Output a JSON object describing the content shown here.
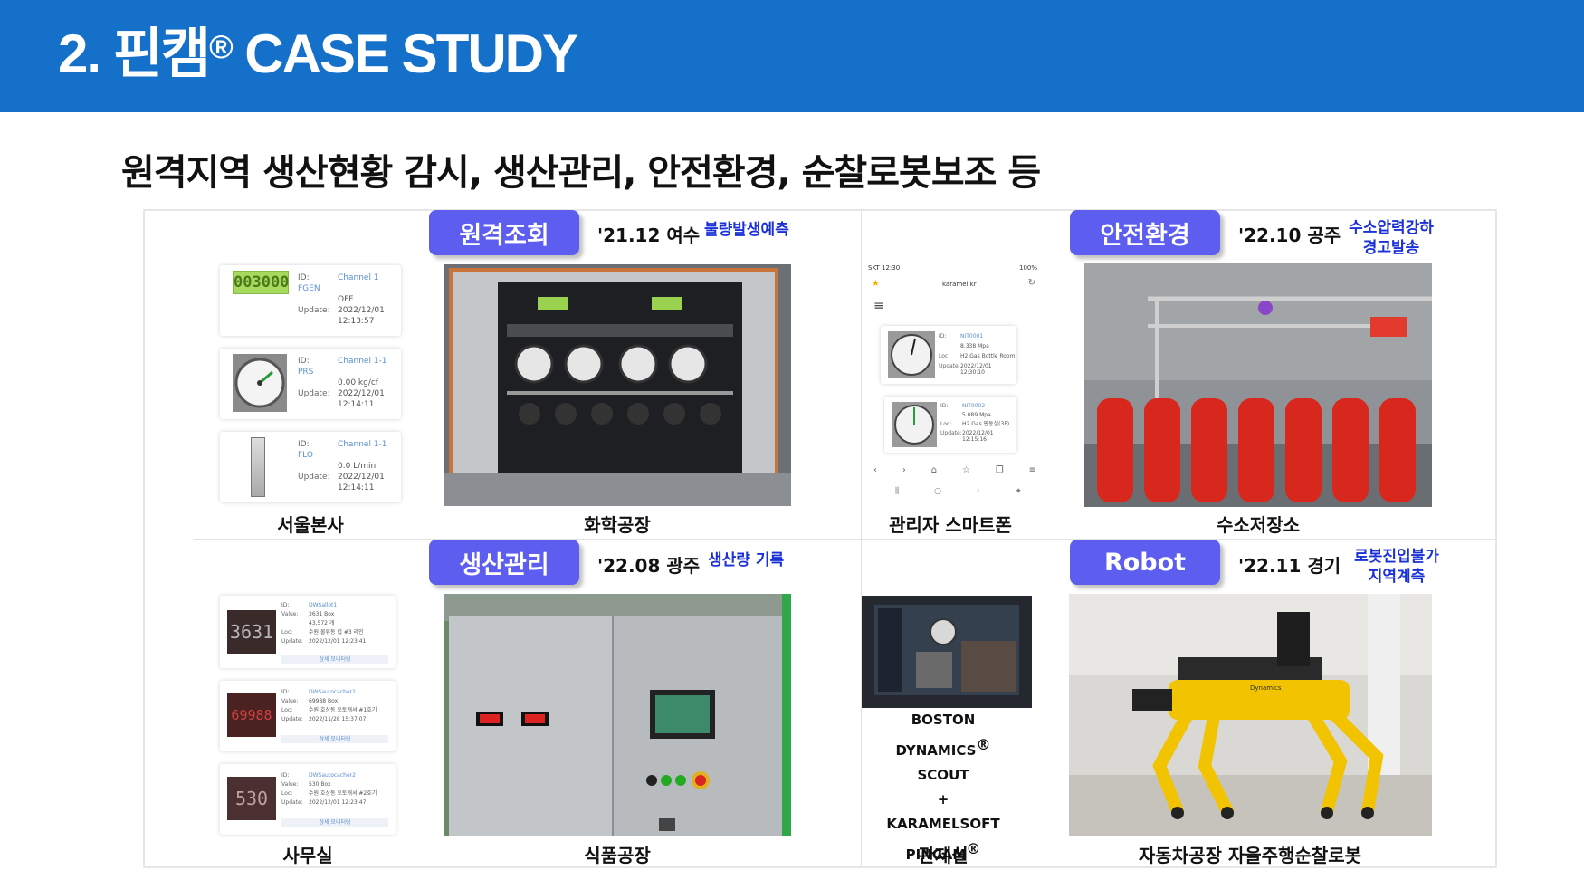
{
  "header": {
    "title": "2. 핀캠",
    "reg": "®",
    "title_rest": " CASE STUDY"
  },
  "subtitle": "원격지역 생산현황 감시, 생산관리, 안전환경, 순찰로봇보조 등",
  "sections": {
    "remote": {
      "badge": "원격조회",
      "meta": "'21.12 여수",
      "note": "불량발생예측"
    },
    "safety": {
      "badge": "안전환경",
      "meta": "'22.10 공주",
      "note_line1": "수소압력강하",
      "note_line2": "경고발송"
    },
    "production": {
      "badge": "생산관리",
      "meta": "'22.08 광주",
      "note": "생산량 기록"
    },
    "robot": {
      "badge": "Robot",
      "meta": "'22.11 경기",
      "note_line1": "로봇진입불가",
      "note_line2": "지역계측"
    }
  },
  "captions": {
    "seoul": "서울본사",
    "chemical": "화학공장",
    "smartphone": "관리자 스마트폰",
    "hydrogen": "수소저장소",
    "office": "사무실",
    "food": "식품공장",
    "control": "관제실",
    "auto": "자동차공장 자율주행순찰로봇"
  },
  "seoul_cards": [
    {
      "display": "003000",
      "id_label": "ID:",
      "id": "Channel 1 FGEN",
      "value": "OFF",
      "update_label": "Update:",
      "update": "2022/12/01",
      "time": "12:13:57"
    },
    {
      "id_label": "ID:",
      "id": "Channel 1-1 PRS",
      "value": "0.00 kg/cf",
      "update_label": "Update:",
      "update": "2022/12/01",
      "time": "12:14:11"
    },
    {
      "id_label": "ID:",
      "id": "Channel 1-1 FLO",
      "value": "0.0 L/min",
      "update_label": "Update:",
      "update": "2022/12/01",
      "time": "12:14:11"
    }
  ],
  "office_cards": [
    {
      "display": "3631",
      "id": "DWSallot1",
      "value": "3631 Box",
      "value2": "43,572 개",
      "loc": "수원 물류동 컵 #3 라인",
      "update": "2022/12/01 12:23:41",
      "link": "상세 모니터링"
    },
    {
      "display": "69988",
      "id": "DWSautocacher1",
      "value": "69988 Box",
      "loc": "수원 호상동 오토캐셔 #1호기",
      "update": "2022/11/28 15:37:07",
      "link": "상세 모니터링"
    },
    {
      "display": "530",
      "id": "DWSautocacher2",
      "value": "530 Box",
      "loc": "수원 호상동 오토캐셔 #2호기",
      "update": "2022/12/01 12:23:47",
      "link": "상세 모니터링"
    }
  ],
  "office_labels": {
    "id": "ID:",
    "value": "Value:",
    "loc": "Loc:",
    "update": "Update:"
  },
  "phone": {
    "status_left": "SKT 12:30",
    "status_right": "100%",
    "url": "karamel.kr",
    "items": [
      {
        "id": "NIT0001",
        "value": "8.338 Mpa",
        "loc": "H2 Gas Bottle Room",
        "update": "2022/12/01",
        "time": "12:30:10"
      },
      {
        "id": "NIT0002",
        "value": "5.089 Mpa",
        "loc": "H2 Gas 판동실(3F)",
        "update": "2022/12/01",
        "time": "12:15:16"
      }
    ],
    "labels": {
      "id": "ID:",
      "loc": "Loc:",
      "update": "Update:"
    }
  },
  "dynamics": {
    "line1": "BOSTON DYNAMICS",
    "reg": "®",
    "line2": "SCOUT",
    "plus": "+",
    "line3": "KARAMELSOFT",
    "line4": "PINCAM"
  },
  "robot_brand": "Dynamics",
  "colors": {
    "header": "#1470c8",
    "badge": "#5d5ef0",
    "note": "#1a30d8",
    "spot_yellow": "#f2c300"
  }
}
